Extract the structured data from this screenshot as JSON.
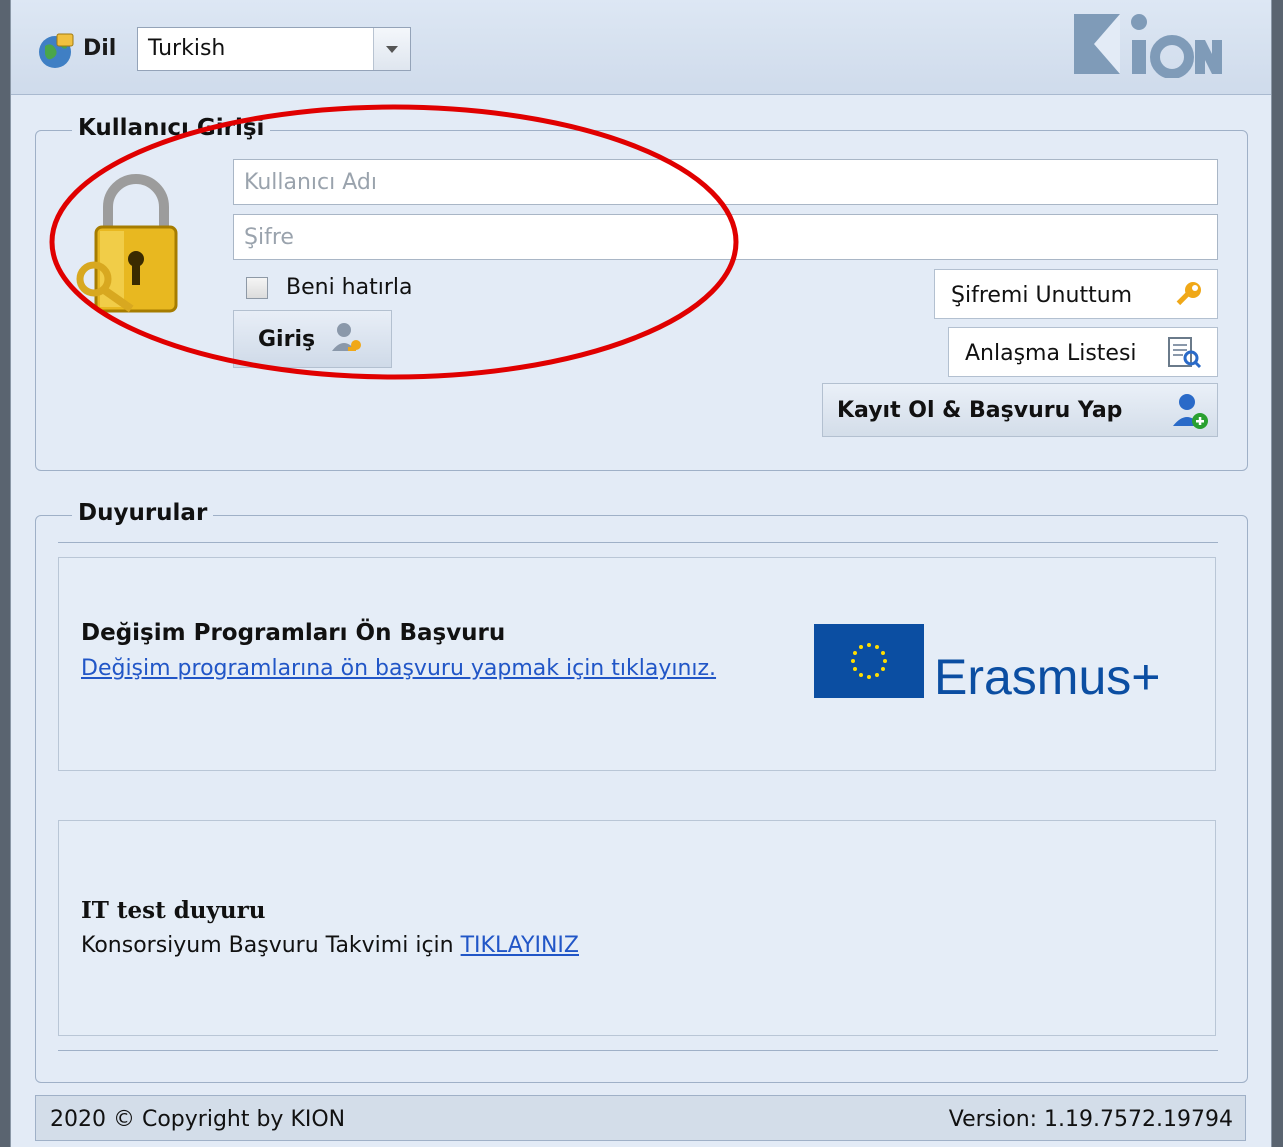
{
  "header": {
    "language_label": "Dil",
    "language_value": "Turkish",
    "logo_text": "KION"
  },
  "login": {
    "title": "Kullanıcı Girişi",
    "username_placeholder": "Kullanıcı Adı",
    "password_placeholder": "Şifre",
    "remember_label": "Beni hatırla",
    "login_button": "Giriş",
    "forgot_button": "Şifremi Unuttum",
    "agreement_list_button": "Anlaşma Listesi",
    "register_button": "Kayıt Ol & Başvuru Yap"
  },
  "announcements": {
    "title": "Duyurular",
    "items": [
      {
        "title": "Değişim Programları Ön Başvuru",
        "link_text": "Değişim programlarına ön başvuru yapmak için tıklayınız.",
        "image_label": "Erasmus+"
      },
      {
        "title": "IT test duyuru",
        "text": "Konsorsiyum Başvuru Takvimi için ",
        "link_text": "TIKLAYINIZ"
      }
    ]
  },
  "footer": {
    "copyright": "2020 © Copyright by KION",
    "version": "Version: 1.19.7572.19794"
  },
  "colors": {
    "background": "#e3ebf6",
    "link": "#2156c7",
    "annotation": "#e00000",
    "eu_blue": "#0b4ea2"
  }
}
